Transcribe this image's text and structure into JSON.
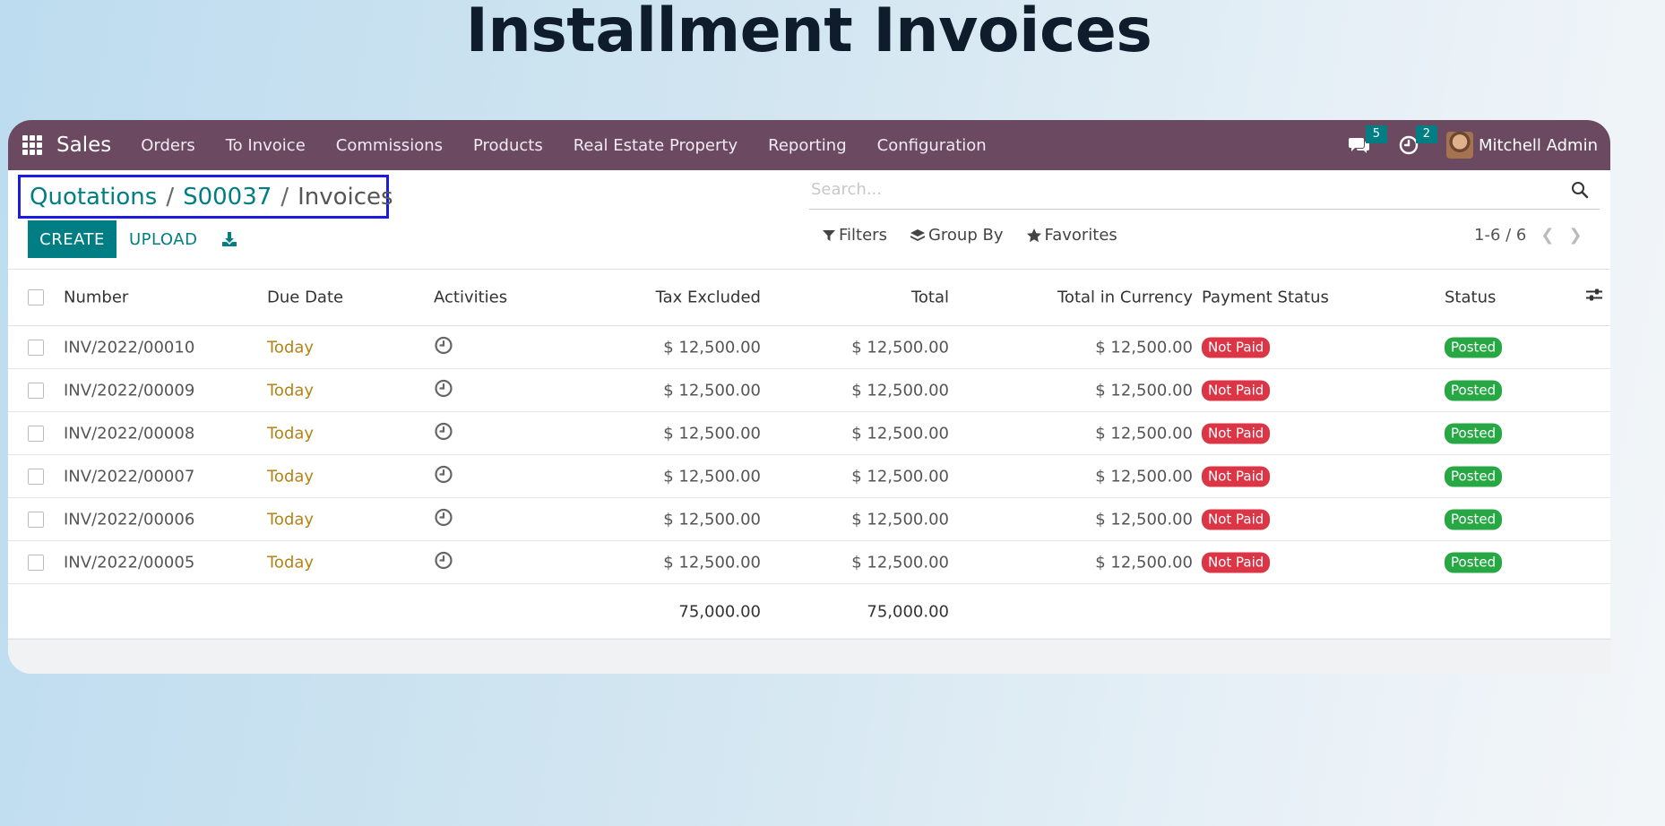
{
  "heading": "Installment Invoices",
  "navbar": {
    "brand": "Sales",
    "menu": [
      "Orders",
      "To Invoice",
      "Commissions",
      "Products",
      "Real Estate Property",
      "Reporting",
      "Configuration"
    ],
    "messages_count": "5",
    "activities_count": "2",
    "user_name": "Mitchell Admin",
    "color": "#6b4a61"
  },
  "breadcrumb": {
    "items": [
      "Quotations",
      "S00037"
    ],
    "current": "Invoices",
    "separator": "/"
  },
  "toolbar": {
    "create_label": "CREATE",
    "upload_label": "UPLOAD"
  },
  "search": {
    "placeholder": "Search..."
  },
  "filters": {
    "filters_label": "Filters",
    "group_by_label": "Group By",
    "favorites_label": "Favorites"
  },
  "pager": {
    "value": "1-6 / 6"
  },
  "table": {
    "headers": {
      "number": "Number",
      "due_date": "Due Date",
      "activities": "Activities",
      "tax_excluded": "Tax Excluded",
      "total": "Total",
      "total_currency": "Total in Currency",
      "payment_status": "Payment Status",
      "status": "Status"
    },
    "rows": [
      {
        "number": "INV/2022/00010",
        "due": "Today",
        "tax": "$ 12,500.00",
        "total": "$ 12,500.00",
        "currency": "$ 12,500.00",
        "payment": "Not Paid",
        "status": "Posted"
      },
      {
        "number": "INV/2022/00009",
        "due": "Today",
        "tax": "$ 12,500.00",
        "total": "$ 12,500.00",
        "currency": "$ 12,500.00",
        "payment": "Not Paid",
        "status": "Posted"
      },
      {
        "number": "INV/2022/00008",
        "due": "Today",
        "tax": "$ 12,500.00",
        "total": "$ 12,500.00",
        "currency": "$ 12,500.00",
        "payment": "Not Paid",
        "status": "Posted"
      },
      {
        "number": "INV/2022/00007",
        "due": "Today",
        "tax": "$ 12,500.00",
        "total": "$ 12,500.00",
        "currency": "$ 12,500.00",
        "payment": "Not Paid",
        "status": "Posted"
      },
      {
        "number": "INV/2022/00006",
        "due": "Today",
        "tax": "$ 12,500.00",
        "total": "$ 12,500.00",
        "currency": "$ 12,500.00",
        "payment": "Not Paid",
        "status": "Posted"
      },
      {
        "number": "INV/2022/00005",
        "due": "Today",
        "tax": "$ 12,500.00",
        "total": "$ 12,500.00",
        "currency": "$ 12,500.00",
        "payment": "Not Paid",
        "status": "Posted"
      }
    ],
    "footer": {
      "tax_total": "75,000.00",
      "total_total": "75,000.00"
    }
  },
  "colors": {
    "accent": "#017e84",
    "not_paid": "#dc3545",
    "posted": "#28a745",
    "due_today": "#b08318",
    "highlight_border": "#1a1ae0"
  }
}
